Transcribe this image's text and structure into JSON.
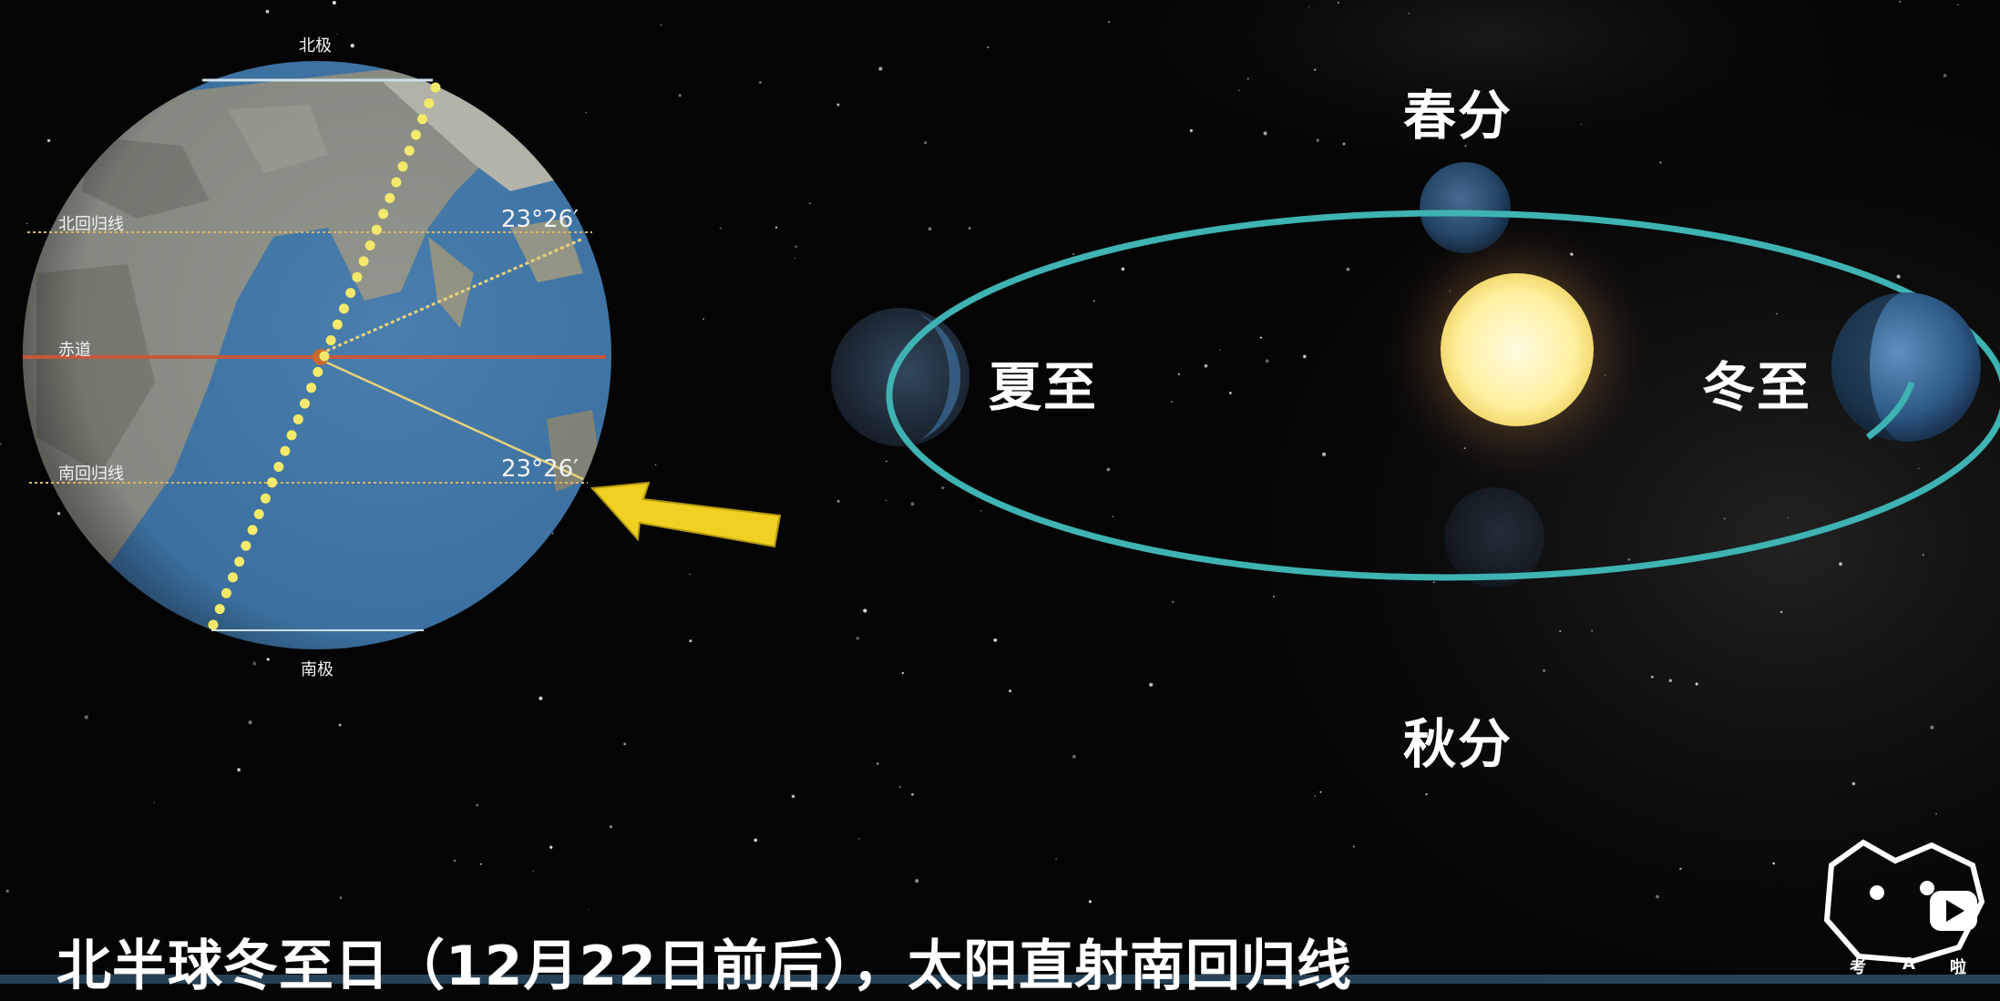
{
  "globe": {
    "north_pole": "北极",
    "south_pole": "南极",
    "tropic_cancer": "北回归线",
    "equator": "赤道",
    "tropic_capricorn": "南回归线",
    "angle_top": "23°26′",
    "angle_bottom": "23°26′"
  },
  "orbit": {
    "spring_equinox": "春分",
    "summer_solstice": "夏至",
    "winter_solstice": "冬至",
    "autumn_equinox": "秋分"
  },
  "caption": "北半球冬至日（12月22日前后），太阳直射南回归线",
  "watermark": {
    "left": "考",
    "mid": "A",
    "right": "啦"
  },
  "colors": {
    "orbit": "#3fb3b3",
    "sun": "#fff4b0",
    "arrow": "#f0d020",
    "terminator_dots": "#f4e96a",
    "ocean": "#3f76a8",
    "land": "#8c8f85",
    "equator_line": "#c8563c"
  }
}
